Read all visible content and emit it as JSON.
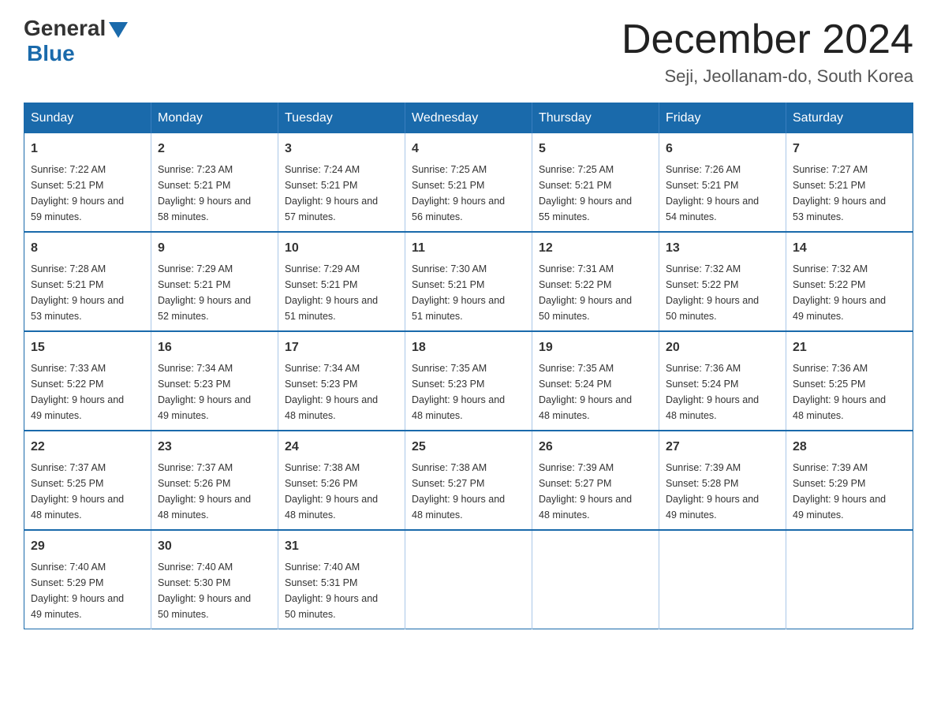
{
  "header": {
    "logo_general": "General",
    "logo_blue": "Blue",
    "month_title": "December 2024",
    "location": "Seji, Jeollanam-do, South Korea"
  },
  "calendar": {
    "days_of_week": [
      "Sunday",
      "Monday",
      "Tuesday",
      "Wednesday",
      "Thursday",
      "Friday",
      "Saturday"
    ],
    "weeks": [
      [
        {
          "day": "1",
          "sunrise": "Sunrise: 7:22 AM",
          "sunset": "Sunset: 5:21 PM",
          "daylight": "Daylight: 9 hours and 59 minutes."
        },
        {
          "day": "2",
          "sunrise": "Sunrise: 7:23 AM",
          "sunset": "Sunset: 5:21 PM",
          "daylight": "Daylight: 9 hours and 58 minutes."
        },
        {
          "day": "3",
          "sunrise": "Sunrise: 7:24 AM",
          "sunset": "Sunset: 5:21 PM",
          "daylight": "Daylight: 9 hours and 57 minutes."
        },
        {
          "day": "4",
          "sunrise": "Sunrise: 7:25 AM",
          "sunset": "Sunset: 5:21 PM",
          "daylight": "Daylight: 9 hours and 56 minutes."
        },
        {
          "day": "5",
          "sunrise": "Sunrise: 7:25 AM",
          "sunset": "Sunset: 5:21 PM",
          "daylight": "Daylight: 9 hours and 55 minutes."
        },
        {
          "day": "6",
          "sunrise": "Sunrise: 7:26 AM",
          "sunset": "Sunset: 5:21 PM",
          "daylight": "Daylight: 9 hours and 54 minutes."
        },
        {
          "day": "7",
          "sunrise": "Sunrise: 7:27 AM",
          "sunset": "Sunset: 5:21 PM",
          "daylight": "Daylight: 9 hours and 53 minutes."
        }
      ],
      [
        {
          "day": "8",
          "sunrise": "Sunrise: 7:28 AM",
          "sunset": "Sunset: 5:21 PM",
          "daylight": "Daylight: 9 hours and 53 minutes."
        },
        {
          "day": "9",
          "sunrise": "Sunrise: 7:29 AM",
          "sunset": "Sunset: 5:21 PM",
          "daylight": "Daylight: 9 hours and 52 minutes."
        },
        {
          "day": "10",
          "sunrise": "Sunrise: 7:29 AM",
          "sunset": "Sunset: 5:21 PM",
          "daylight": "Daylight: 9 hours and 51 minutes."
        },
        {
          "day": "11",
          "sunrise": "Sunrise: 7:30 AM",
          "sunset": "Sunset: 5:21 PM",
          "daylight": "Daylight: 9 hours and 51 minutes."
        },
        {
          "day": "12",
          "sunrise": "Sunrise: 7:31 AM",
          "sunset": "Sunset: 5:22 PM",
          "daylight": "Daylight: 9 hours and 50 minutes."
        },
        {
          "day": "13",
          "sunrise": "Sunrise: 7:32 AM",
          "sunset": "Sunset: 5:22 PM",
          "daylight": "Daylight: 9 hours and 50 minutes."
        },
        {
          "day": "14",
          "sunrise": "Sunrise: 7:32 AM",
          "sunset": "Sunset: 5:22 PM",
          "daylight": "Daylight: 9 hours and 49 minutes."
        }
      ],
      [
        {
          "day": "15",
          "sunrise": "Sunrise: 7:33 AM",
          "sunset": "Sunset: 5:22 PM",
          "daylight": "Daylight: 9 hours and 49 minutes."
        },
        {
          "day": "16",
          "sunrise": "Sunrise: 7:34 AM",
          "sunset": "Sunset: 5:23 PM",
          "daylight": "Daylight: 9 hours and 49 minutes."
        },
        {
          "day": "17",
          "sunrise": "Sunrise: 7:34 AM",
          "sunset": "Sunset: 5:23 PM",
          "daylight": "Daylight: 9 hours and 48 minutes."
        },
        {
          "day": "18",
          "sunrise": "Sunrise: 7:35 AM",
          "sunset": "Sunset: 5:23 PM",
          "daylight": "Daylight: 9 hours and 48 minutes."
        },
        {
          "day": "19",
          "sunrise": "Sunrise: 7:35 AM",
          "sunset": "Sunset: 5:24 PM",
          "daylight": "Daylight: 9 hours and 48 minutes."
        },
        {
          "day": "20",
          "sunrise": "Sunrise: 7:36 AM",
          "sunset": "Sunset: 5:24 PM",
          "daylight": "Daylight: 9 hours and 48 minutes."
        },
        {
          "day": "21",
          "sunrise": "Sunrise: 7:36 AM",
          "sunset": "Sunset: 5:25 PM",
          "daylight": "Daylight: 9 hours and 48 minutes."
        }
      ],
      [
        {
          "day": "22",
          "sunrise": "Sunrise: 7:37 AM",
          "sunset": "Sunset: 5:25 PM",
          "daylight": "Daylight: 9 hours and 48 minutes."
        },
        {
          "day": "23",
          "sunrise": "Sunrise: 7:37 AM",
          "sunset": "Sunset: 5:26 PM",
          "daylight": "Daylight: 9 hours and 48 minutes."
        },
        {
          "day": "24",
          "sunrise": "Sunrise: 7:38 AM",
          "sunset": "Sunset: 5:26 PM",
          "daylight": "Daylight: 9 hours and 48 minutes."
        },
        {
          "day": "25",
          "sunrise": "Sunrise: 7:38 AM",
          "sunset": "Sunset: 5:27 PM",
          "daylight": "Daylight: 9 hours and 48 minutes."
        },
        {
          "day": "26",
          "sunrise": "Sunrise: 7:39 AM",
          "sunset": "Sunset: 5:27 PM",
          "daylight": "Daylight: 9 hours and 48 minutes."
        },
        {
          "day": "27",
          "sunrise": "Sunrise: 7:39 AM",
          "sunset": "Sunset: 5:28 PM",
          "daylight": "Daylight: 9 hours and 49 minutes."
        },
        {
          "day": "28",
          "sunrise": "Sunrise: 7:39 AM",
          "sunset": "Sunset: 5:29 PM",
          "daylight": "Daylight: 9 hours and 49 minutes."
        }
      ],
      [
        {
          "day": "29",
          "sunrise": "Sunrise: 7:40 AM",
          "sunset": "Sunset: 5:29 PM",
          "daylight": "Daylight: 9 hours and 49 minutes."
        },
        {
          "day": "30",
          "sunrise": "Sunrise: 7:40 AM",
          "sunset": "Sunset: 5:30 PM",
          "daylight": "Daylight: 9 hours and 50 minutes."
        },
        {
          "day": "31",
          "sunrise": "Sunrise: 7:40 AM",
          "sunset": "Sunset: 5:31 PM",
          "daylight": "Daylight: 9 hours and 50 minutes."
        },
        null,
        null,
        null,
        null
      ]
    ]
  }
}
